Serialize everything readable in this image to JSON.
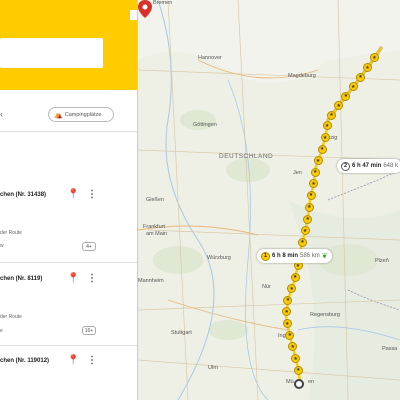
{
  "sidebar": {
    "filter_chip": {
      "label": "Campingplätze",
      "icon": "tent-icon"
    },
    "results": [
      {
        "title": "chen (Nr. 31438)",
        "sub": "der Route",
        "meta": "w",
        "count": "4+"
      },
      {
        "title": "chen (Nr. 8119)",
        "sub": "der Route",
        "meta": "e",
        "count": "16+"
      },
      {
        "title": "chen (Nr. 119012)",
        "sub": "",
        "meta": "",
        "count": ""
      }
    ]
  },
  "map": {
    "labels": {
      "bremen": "Bremen",
      "hannover": "Hannover",
      "magdeburg": "Magdeburg",
      "goettingen": "Göttingen",
      "leipzig": "ipzig",
      "country": "DEUTSCHLAND",
      "jena": "Jen",
      "giessen": "Gießen",
      "frankfurt1": "Frankfurt",
      "frankfurt2": "am Main",
      "wuerzburg": "Würzburg",
      "mannheim": "Mannheim",
      "nuernberg": "Nür",
      "regensburg": "Regensburg",
      "stuttgart": "Stuttgart",
      "ulm": "Ulm",
      "ingolstadt": "Ing",
      "muenchen": "Mü",
      "muenchen_tail": "en",
      "plzen": "Plzeň",
      "passau": "Passa"
    },
    "routes": [
      {
        "num": "2",
        "duration": "6 h 47 min",
        "distance": "648 k"
      },
      {
        "num": "1",
        "duration": "6 h 8 min",
        "distance": "586 km"
      }
    ],
    "colors": {
      "route_main": "#FFCC00",
      "route_alt": "#3a7dd1",
      "accent": "#FFCC00",
      "destination_pin": "#d9302b"
    }
  }
}
